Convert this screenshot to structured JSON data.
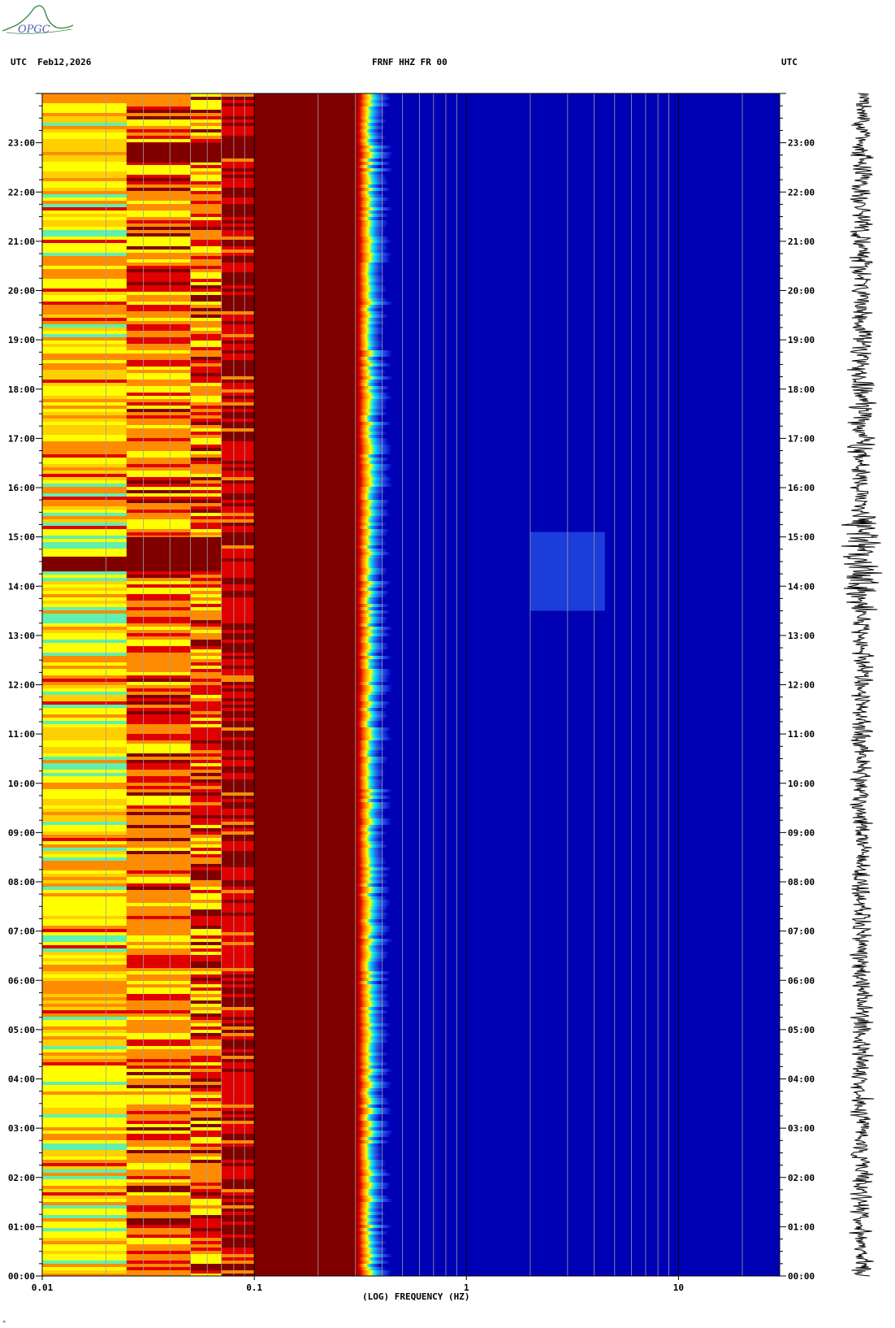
{
  "header": {
    "left": "UTC  Feb12,2026",
    "center": "FRNF HHZ FR 00",
    "right": "UTC"
  },
  "logo": {
    "text": "OPGC"
  },
  "colors": {
    "dark_red": "#800000",
    "red": "#e00000",
    "orange": "#ff8c00",
    "yellow": "#ffff00",
    "cyan": "#00e0ff",
    "blue": "#0000b4",
    "grid": "#a0a0a0"
  },
  "chart_data": {
    "type": "heatmap",
    "title": "FRNF HHZ FR 00",
    "xlabel": "(LOG) FREQUENCY (HZ)",
    "ylabel": "UTC",
    "x_scale": "log",
    "xlim": [
      0.01,
      30
    ],
    "x_tick_labels": [
      "0.01",
      "0.1",
      "1",
      "10"
    ],
    "ylim_hours": [
      0,
      24
    ],
    "y_tick_labels": [
      "00:00",
      "01:00",
      "02:00",
      "03:00",
      "04:00",
      "05:00",
      "06:00",
      "07:00",
      "08:00",
      "09:00",
      "10:00",
      "11:00",
      "12:00",
      "13:00",
      "14:00",
      "15:00",
      "16:00",
      "17:00",
      "18:00",
      "19:00",
      "20:00",
      "21:00",
      "22:00",
      "23:00"
    ],
    "colormap": [
      "blue",
      "cyan",
      "yellow",
      "orange",
      "red",
      "dark_red"
    ],
    "bands_hz": [
      {
        "from": 0.01,
        "to": 0.025,
        "level": "yellow/orange"
      },
      {
        "from": 0.025,
        "to": 0.07,
        "level": "orange/red"
      },
      {
        "from": 0.07,
        "to": 0.1,
        "level": "red"
      },
      {
        "from": 0.1,
        "to": 0.3,
        "level": "dark_red"
      },
      {
        "from": 0.3,
        "to": 0.45,
        "level": "red/orange/yellow"
      },
      {
        "from": 0.45,
        "to": 0.8,
        "level": "cyan/blue"
      },
      {
        "from": 0.8,
        "to": 30,
        "level": "blue"
      }
    ],
    "events": [
      {
        "hour_from": 13.5,
        "hour_to": 15.1,
        "hz_from": 2.0,
        "hz_to": 4.5,
        "level": "light blue"
      }
    ]
  },
  "footer": {
    "corner_mark": "ᴹ"
  }
}
